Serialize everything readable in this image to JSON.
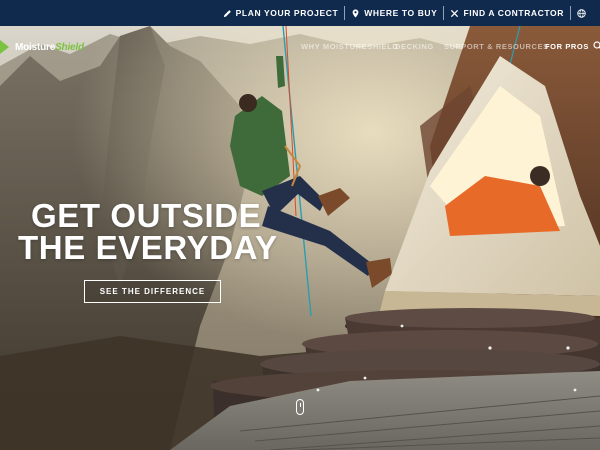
{
  "utility_bar": {
    "links": [
      {
        "label": "PLAN YOUR PROJECT",
        "icon": "pencil-icon"
      },
      {
        "label": "WHERE TO BUY",
        "icon": "map-pin-icon"
      },
      {
        "label": "FIND A CONTRACTOR",
        "icon": "tools-icon"
      },
      {
        "label": "",
        "icon": "globe-icon"
      }
    ]
  },
  "nav": {
    "logo": {
      "part1": "Moisture",
      "part2": "Shield"
    },
    "items": [
      "WHY MOISTURESHIELD",
      "DECKING",
      "SUPPORT & RESOURCES",
      "FOR PROS"
    ]
  },
  "hero": {
    "headline_line1": "GET OUTSIDE",
    "headline_line2": "THE EVERYDAY",
    "cta_label": "SEE THE DIFFERENCE"
  },
  "colors": {
    "utility_bar_bg": "#0f2a4d",
    "brand_green": "#7cc242",
    "text_white": "#ffffff"
  }
}
